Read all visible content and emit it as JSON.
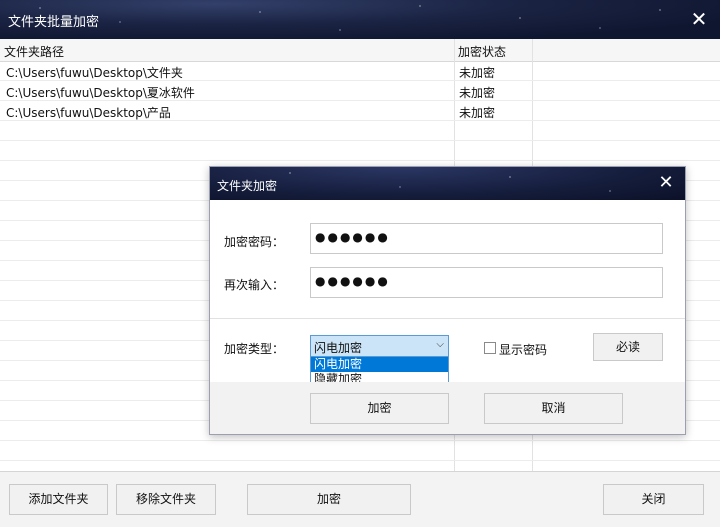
{
  "window": {
    "title": "文件夹批量加密",
    "close_glyph": "✕"
  },
  "table": {
    "headers": [
      "文件夹路径",
      "加密状态"
    ],
    "rows": [
      {
        "path": "C:\\Users\\fuwu\\Desktop\\文件夹",
        "status": "未加密"
      },
      {
        "path": "C:\\Users\\fuwu\\Desktop\\夏冰软件",
        "status": "未加密"
      },
      {
        "path": "C:\\Users\\fuwu\\Desktop\\产品",
        "status": "未加密"
      }
    ]
  },
  "toolbar": {
    "add_label": "添加文件夹",
    "remove_label": "移除文件夹",
    "encrypt_label": "加密",
    "close_label": "关闭"
  },
  "dialog": {
    "title": "文件夹加密",
    "close_glyph": "✕",
    "password_label": "加密密码：",
    "password_value": "●●●●●●",
    "confirm_label": "再次输入：",
    "confirm_value": "●●●●●●",
    "type_label": "加密类型：",
    "type_selected": "闪电加密",
    "type_options": [
      "闪电加密",
      "隐藏加密"
    ],
    "show_password_label": "显示密码",
    "must_read_label": "必读",
    "encrypt_label": "加密",
    "cancel_label": "取消"
  }
}
